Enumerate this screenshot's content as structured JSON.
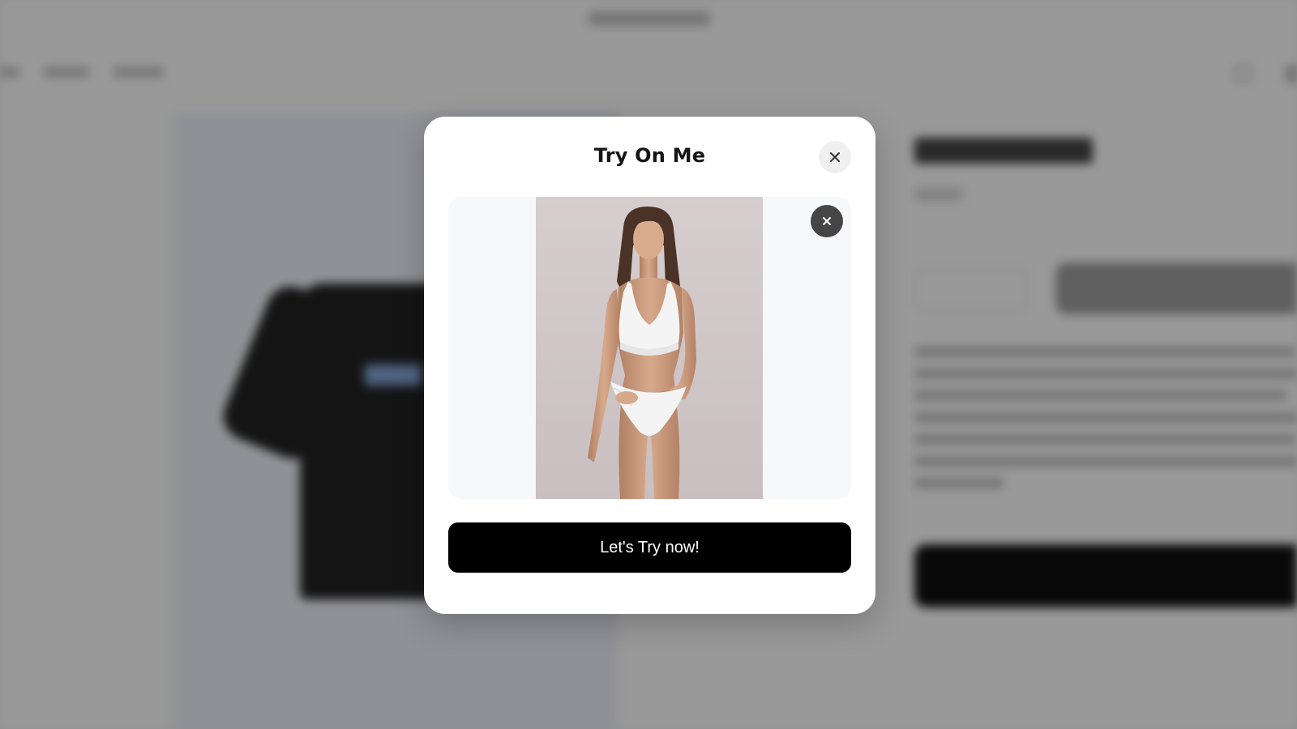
{
  "modal": {
    "title": "Try On Me",
    "close_icon": "close-icon",
    "preview": {
      "remove_icon": "close-icon"
    },
    "try_button_label": "Let's Try now!"
  },
  "colors": {
    "modal_bg": "#ffffff",
    "button_bg": "#000000",
    "button_text": "#ffffff",
    "preview_bg": "#f7f8fa",
    "remove_button_bg": "#454545"
  }
}
